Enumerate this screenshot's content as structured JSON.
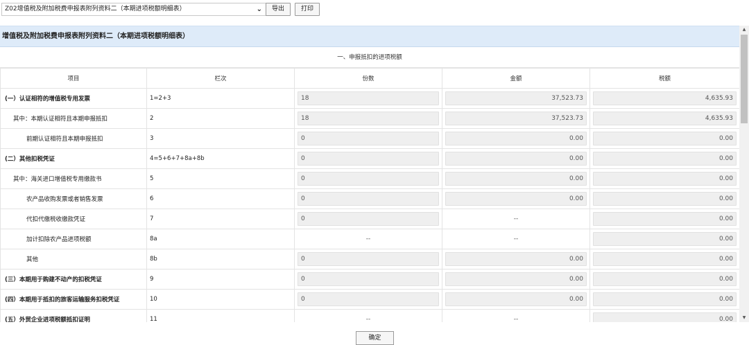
{
  "toolbar": {
    "report_select_value": "Z02增值税及附加税费申报表附列资料二（本期进项税额明细表）",
    "export_label": "导出",
    "print_label": "打印"
  },
  "panel": {
    "title": "增值税及附加税费申报表附列资料二（本期进项税额明细表）",
    "section": "一、申报抵扣的进项税额",
    "headers": [
      "项目",
      "栏次",
      "份数",
      "金额",
      "税额"
    ],
    "rows": [
      {
        "item": "(一）认证相符的增值税专用发票",
        "col": "1=2+3",
        "copies": "18",
        "amount": "37,523.73",
        "tax": "4,635.93"
      },
      {
        "item": "其中：本期认证相符且本期申报抵扣",
        "col": "2",
        "copies": "18",
        "amount": "37,523.73",
        "tax": "4,635.93"
      },
      {
        "item": "前期认证相符且本期申报抵扣",
        "col": "3",
        "copies": "0",
        "amount": "0.00",
        "tax": "0.00"
      },
      {
        "item": "(二）其他扣税凭证",
        "col": "4=5+6+7+8a+8b",
        "copies": "0",
        "amount": "0.00",
        "tax": "0.00"
      },
      {
        "item": "其中：海关进口增值税专用缴款书",
        "col": "5",
        "copies": "0",
        "amount": "0.00",
        "tax": "0.00"
      },
      {
        "item": "农产品收购发票或者销售发票",
        "col": "6",
        "copies": "0",
        "amount": "0.00",
        "tax": "0.00"
      },
      {
        "item": "代扣代缴税收缴款凭证",
        "col": "7",
        "copies": "0",
        "amount": "--",
        "tax": "0.00"
      },
      {
        "item": "加计扣除农产品进项税额",
        "col": "8a",
        "copies": "--",
        "amount": "--",
        "tax": "0.00"
      },
      {
        "item": "其他",
        "col": "8b",
        "copies": "0",
        "amount": "0.00",
        "tax": "0.00"
      },
      {
        "item": "(三）本期用于购建不动产的扣税凭证",
        "col": "9",
        "copies": "0",
        "amount": "0.00",
        "tax": "0.00"
      },
      {
        "item": "(四）本期用于抵扣的旅客运输服务扣税凭证",
        "col": "10",
        "copies": "0",
        "amount": "0.00",
        "tax": "0.00"
      },
      {
        "item": "(五）外贸企业进项税额抵扣证明",
        "col": "11",
        "copies": "--",
        "amount": "--",
        "tax": "0.00"
      }
    ]
  },
  "confirm_label": "确定"
}
